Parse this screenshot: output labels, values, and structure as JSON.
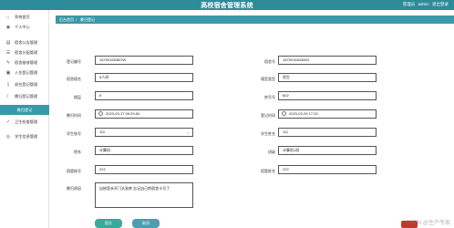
{
  "app": {
    "title": "高校宿舍管理系统",
    "user_label": "管理员",
    "user_name": "admin",
    "logout_label": "退出登录"
  },
  "sidebar": {
    "items": [
      {
        "label": "系统首页",
        "icon": "home-icon"
      },
      {
        "label": "个人中心",
        "icon": "user-icon"
      },
      {
        "label": "宿舍公告管理",
        "icon": "notice-icon"
      },
      {
        "label": "宿舍分配管理",
        "icon": "list-icon"
      },
      {
        "label": "宿舍维修管理",
        "icon": "wrench-icon"
      },
      {
        "label": "人住登记管理",
        "icon": "clipboard-icon"
      },
      {
        "label": "退住登记管理",
        "icon": "door-icon"
      },
      {
        "label": "晚归登记管理",
        "icon": "moon-icon"
      },
      {
        "label": "晚归登记",
        "icon": "",
        "active": true
      },
      {
        "label": "卫生检查管理",
        "icon": "check-icon"
      },
      {
        "label": "学生信息管理",
        "icon": "people-icon"
      }
    ]
  },
  "breadcrumb": {
    "home": "后台首页",
    "current": "晚归登记"
  },
  "form": {
    "fields": {
      "register_no": {
        "label": "登记编号",
        "value": "1679016536OW"
      },
      "room_no_left": {
        "label": "宿舍号",
        "value": "1679016544563"
      },
      "building": {
        "label": "宿舍楼名",
        "value": "6人间"
      },
      "room_type": {
        "label": "寝室类型",
        "value": "男生"
      },
      "floor": {
        "label": "楼层",
        "value": "6"
      },
      "room_num": {
        "label": "房号号",
        "value": "602"
      },
      "return_time": {
        "label": "晚归时间",
        "value": "2023-03-17 09:29:54"
      },
      "register_time": {
        "label": "登记时间",
        "value": "2023-03-29 17:23"
      },
      "student_no": {
        "label": "学生账号",
        "value": "111"
      },
      "student_name": {
        "label": "学生姓名",
        "value": "111"
      },
      "college": {
        "label": "院系",
        "value": "计算机"
      },
      "class": {
        "label": "班级",
        "value": "计算机1班"
      },
      "dorm_admin": {
        "label": "宿管账号",
        "value": "222"
      },
      "dorm_admin_name": {
        "label": "宿管姓名",
        "value": "222"
      },
      "reason": {
        "label": "晚归原因",
        "value": "自修室未开门头发疼 忘记自己的宿舍卡号了"
      }
    },
    "submit_label": "提交",
    "cancel_label": "取消"
  },
  "watermark": "CSDN @生产专家",
  "colors": {
    "topbar": "#2e8b99",
    "accent": "#3a98a8",
    "submit": "#3aa89a"
  }
}
